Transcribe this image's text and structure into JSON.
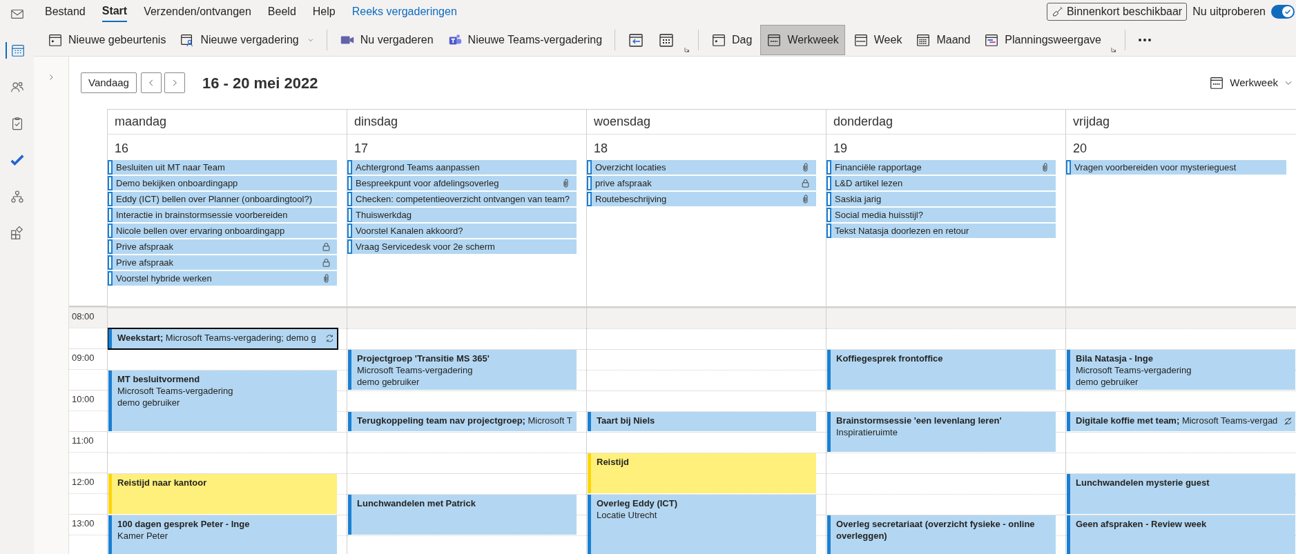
{
  "rail": [
    {
      "selected": false
    },
    {
      "selected": true
    },
    {
      "selected": false
    },
    {
      "selected": false
    },
    {
      "selected": false
    },
    {
      "selected": false
    },
    {
      "selected": false
    }
  ],
  "menu_tabs": [
    {
      "label": "Bestand",
      "selected": false,
      "kind": "tab"
    },
    {
      "label": "Start",
      "selected": true,
      "kind": "tab"
    },
    {
      "label": "Verzenden/ontvangen",
      "selected": false,
      "kind": "tab"
    },
    {
      "label": "Beeld",
      "selected": false,
      "kind": "tab"
    },
    {
      "label": "Help",
      "selected": false,
      "kind": "tab"
    },
    {
      "label": "Reeks vergaderingen",
      "selected": false,
      "kind": "contextual"
    }
  ],
  "coming_soon": {
    "label": "Binnenkort beschikbaar",
    "toggle_label": "Nu uitproberen",
    "on": true
  },
  "ribbon": [
    {
      "kind": "button",
      "label": "Nieuwe gebeurtenis"
    },
    {
      "kind": "dropdown",
      "label": "Nieuwe vergadering"
    },
    {
      "kind": "separator"
    },
    {
      "kind": "button",
      "label": "Nu vergaderen"
    },
    {
      "kind": "button",
      "label": "Nieuwe Teams-vergadering"
    },
    {
      "kind": "separator"
    },
    {
      "kind": "icon"
    },
    {
      "kind": "icon"
    },
    {
      "kind": "launcher"
    },
    {
      "kind": "separator"
    },
    {
      "kind": "view",
      "label": "Dag",
      "selected": false
    },
    {
      "kind": "view",
      "label": "Werkweek",
      "selected": true
    },
    {
      "kind": "view",
      "label": "Week",
      "selected": false
    },
    {
      "kind": "view",
      "label": "Maand",
      "selected": false
    },
    {
      "kind": "view",
      "label": "Planningsweergave",
      "selected": false
    },
    {
      "kind": "launcher"
    },
    {
      "kind": "separator"
    },
    {
      "kind": "more"
    }
  ],
  "header": {
    "today": "Vandaag",
    "range": "16 - 20 mei 2022",
    "view": "Werkweek"
  },
  "times": [
    "08:00",
    "09:00",
    "10:00",
    "11:00",
    "12:00",
    "13:00"
  ],
  "days": [
    {
      "name": "maandag",
      "date": "16",
      "all_day": [
        {
          "title": "Besluiten uit MT naar Team",
          "private": false,
          "attachment": false
        },
        {
          "title": "Demo bekijken onboardingapp",
          "private": false,
          "attachment": false
        },
        {
          "title": "Eddy (ICT) bellen over Planner (onboardingtool?)",
          "private": false,
          "attachment": false
        },
        {
          "title": "Interactie in brainstormsessie voorbereiden",
          "private": false,
          "attachment": false
        },
        {
          "title": "Nicole bellen over ervaring onboardingapp",
          "private": false,
          "attachment": false
        },
        {
          "title": "Prive afspraak",
          "private": true,
          "attachment": false
        },
        {
          "title": "Prive afspraak",
          "private": true,
          "attachment": false
        },
        {
          "title": "Voorstel hybride werken",
          "private": false,
          "attachment": true
        }
      ],
      "events": [
        {
          "title": "**Weekstart;** Microsoft Teams-vergadering; demo g",
          "color": "#b3d7f2",
          "kind": "recurring",
          "selected": true
        },
        {
          "title": "MT besluitvormend",
          "details": [
            "Microsoft Teams-vergadering",
            "demo gebruiker"
          ],
          "color": "#b3d7f2",
          "kind": "single",
          "selected": false
        },
        {
          "title": "Reistijd naar kantoor",
          "color": "#fef07a",
          "kind": "single",
          "selected": false
        },
        {
          "title": "100 dagen gesprek Peter - Inge",
          "details": [
            "Kamer Peter"
          ],
          "color": "#b3d7f2",
          "kind": "single",
          "selected": false
        }
      ]
    },
    {
      "name": "dinsdag",
      "date": "17",
      "all_day": [
        {
          "title": "Achtergrond Teams aanpassen",
          "private": false,
          "attachment": false
        },
        {
          "title": "Bespreekpunt voor afdelingsoverleg",
          "private": false,
          "attachment": true
        },
        {
          "title": "Checken: competentieoverzicht ontvangen van team?",
          "private": false,
          "attachment": false
        },
        {
          "title": "Thuiswerkdag",
          "private": false,
          "attachment": false
        },
        {
          "title": "Voorstel Kanalen akkoord?",
          "private": false,
          "attachment": false
        },
        {
          "title": "Vraag Servicedesk voor 2e scherm",
          "private": false,
          "attachment": false
        }
      ],
      "events": [
        {
          "title": "Projectgroep 'Transitie MS 365'",
          "details": [
            "Microsoft Teams-vergadering",
            "demo gebruiker"
          ],
          "color": "#b3d7f2",
          "kind": "single",
          "selected": false
        },
        {
          "title": "**Terugkoppeling team nav projectgroep;** Microsoft T",
          "color": "#b3d7f2",
          "kind": "single",
          "selected": false
        },
        {
          "title": "Lunchwandelen met Patrick",
          "color": "#b3d7f2",
          "kind": "single",
          "selected": false
        }
      ]
    },
    {
      "name": "woensdag",
      "date": "18",
      "all_day": [
        {
          "title": "Overzicht locaties",
          "private": false,
          "attachment": true
        },
        {
          "title": "prive afspraak",
          "private": true,
          "attachment": false
        },
        {
          "title": "Routebeschrijving",
          "private": false,
          "attachment": true
        }
      ],
      "events": [
        {
          "title": "Taart bij Niels",
          "color": "#b3d7f2",
          "kind": "single",
          "selected": false
        },
        {
          "title": "Reistijd",
          "color": "#fef07a",
          "kind": "single",
          "selected": false
        },
        {
          "title": "Overleg Eddy (ICT)",
          "details": [
            "Locatie Utrecht"
          ],
          "color": "#b3d7f2",
          "kind": "single",
          "selected": false
        }
      ]
    },
    {
      "name": "donderdag",
      "date": "19",
      "all_day": [
        {
          "title": "Financiële rapportage",
          "private": false,
          "attachment": true
        },
        {
          "title": "L&D artikel lezen",
          "private": false,
          "attachment": false
        },
        {
          "title": "Saskia jarig",
          "private": false,
          "attachment": false
        },
        {
          "title": "Social media huisstijl?",
          "private": false,
          "attachment": false
        },
        {
          "title": "Tekst Natasja doorlezen en retour",
          "private": false,
          "attachment": false
        }
      ],
      "events": [
        {
          "title": "Koffiegesprek frontoffice",
          "color": "#b3d7f2",
          "kind": "single",
          "selected": false
        },
        {
          "title": "Brainstormsessie 'een levenlang leren'",
          "details": [
            "Inspiratieruimte"
          ],
          "color": "#b3d7f2",
          "kind": "single",
          "selected": false
        },
        {
          "title": "Overleg secretariaat (overzicht fysieke - online overleggen)",
          "color": "#b3d7f2",
          "kind": "single",
          "selected": false
        }
      ]
    },
    {
      "name": "vrijdag",
      "date": "20",
      "all_day": [
        {
          "title": "Vragen voorbereiden voor mysterieguest",
          "private": false,
          "attachment": false
        }
      ],
      "events": [
        {
          "title": "Bila Natasja - Inge",
          "details": [
            "Microsoft Teams-vergadering",
            "demo gebruiker"
          ],
          "color": "#b3d7f2",
          "kind": "single",
          "selected": false
        },
        {
          "title": "**Digitale koffie met team;** Microsoft Teams-vergad",
          "color": "#b3d7f2",
          "kind": "exception",
          "selected": false
        },
        {
          "title": "Lunchwandelen mysterie guest",
          "color": "#b3d7f2",
          "kind": "single",
          "selected": false
        },
        {
          "title": "Geen afspraken - Review week",
          "color": "#b3d7f2",
          "kind": "single",
          "selected": false
        }
      ]
    }
  ]
}
